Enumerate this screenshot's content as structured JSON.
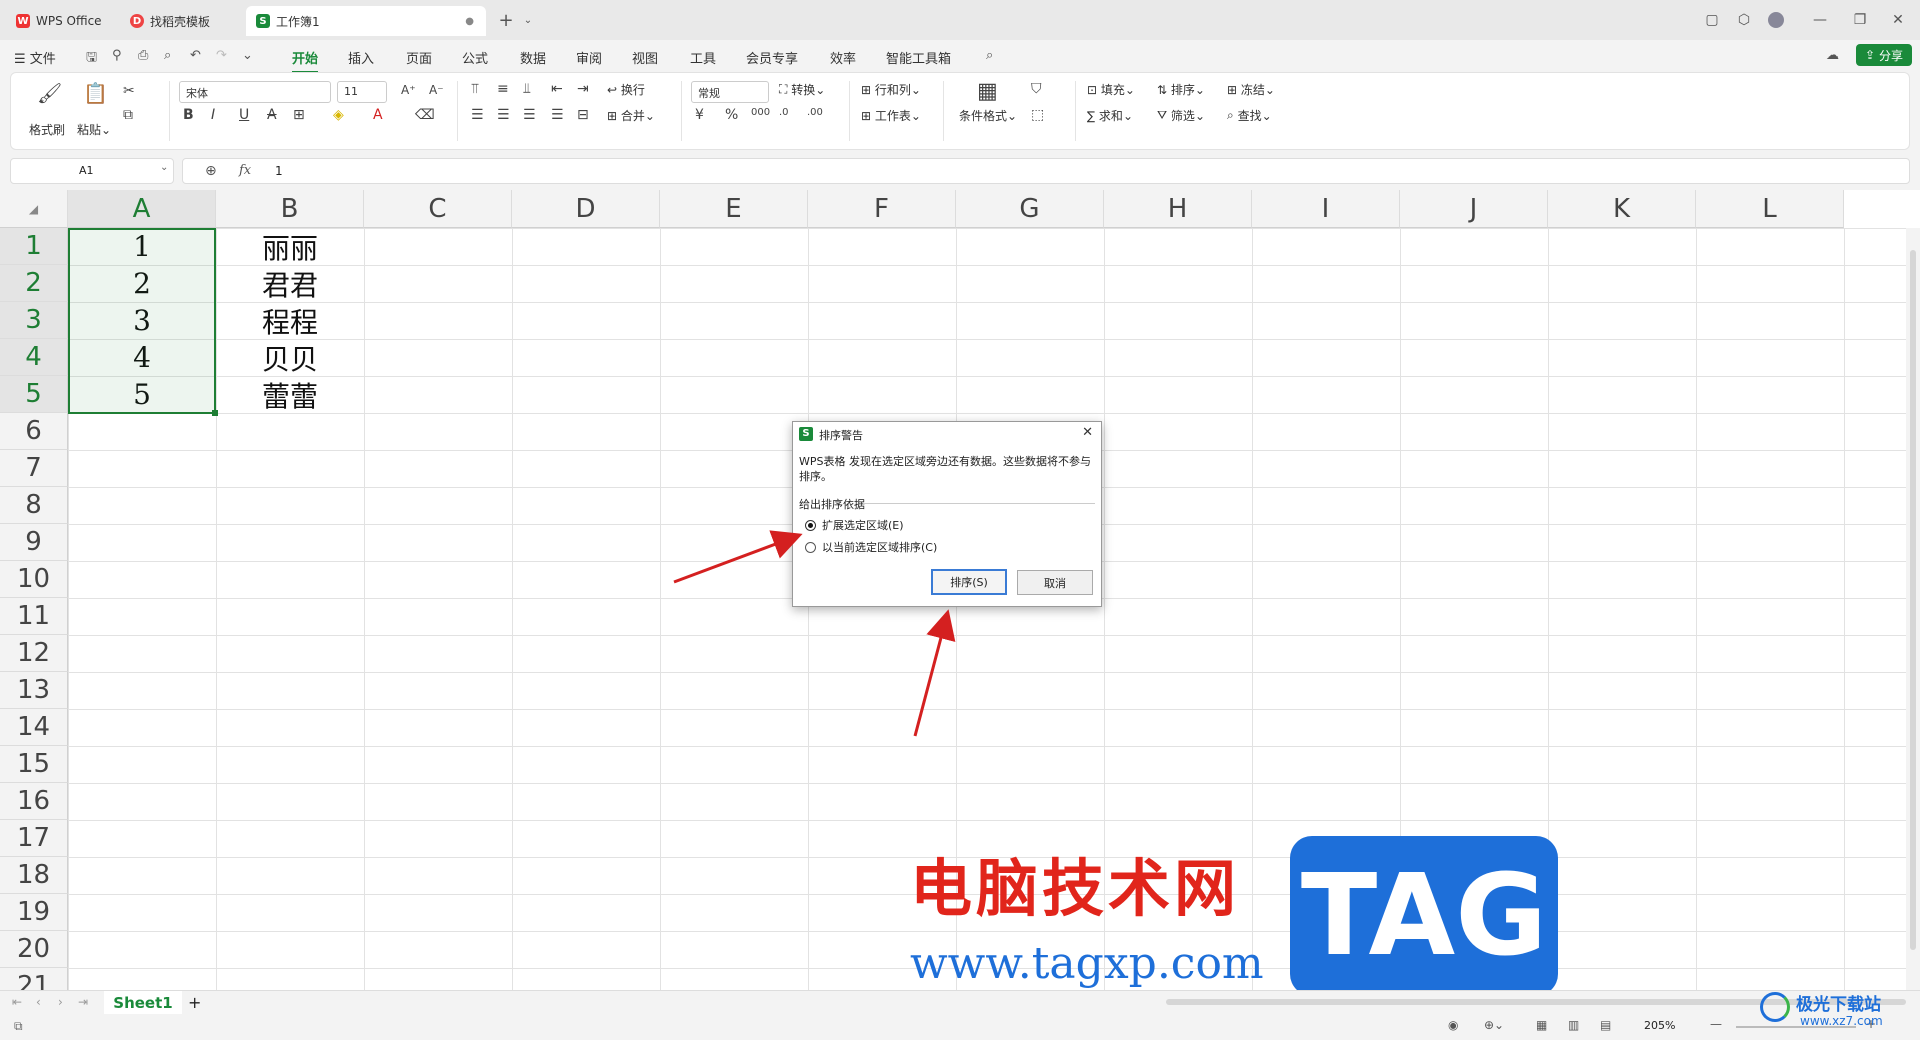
{
  "titlebar": {
    "tabs": [
      {
        "label": "WPS Office",
        "icon": "wps-logo-icon"
      },
      {
        "label": "找稻壳模板",
        "icon": "docer-icon"
      },
      {
        "label": "工作簿1",
        "icon": "sheet-s-icon"
      }
    ]
  },
  "menubar": {
    "file": "文件",
    "items": [
      "开始",
      "插入",
      "页面",
      "公式",
      "数据",
      "审阅",
      "视图",
      "工具",
      "会员专享",
      "效率",
      "智能工具箱"
    ],
    "share": "分享"
  },
  "ribbon": {
    "format_painter": "格式刷",
    "paste": "粘贴",
    "font": "宋体",
    "font_size": "11",
    "wrap": "换行",
    "merge": "合并",
    "number_format": "常规",
    "convert": "转换",
    "row_col": "行和列",
    "worksheet": "工作表",
    "cond_format": "条件格式",
    "fill": "填充",
    "sort": "排序",
    "freeze": "冻结",
    "sum": "求和",
    "filter": "筛选",
    "find": "查找"
  },
  "formula_bar": {
    "cell_ref": "A1",
    "fx": "fx",
    "value": "1"
  },
  "sheet": {
    "columns": [
      "A",
      "B",
      "C",
      "D",
      "E",
      "F",
      "G",
      "H",
      "I",
      "J",
      "K",
      "L"
    ],
    "rows": [
      "1",
      "2",
      "3",
      "4",
      "5",
      "6",
      "7",
      "8",
      "9",
      "10",
      "11",
      "12",
      "13",
      "14",
      "15",
      "16",
      "17",
      "18",
      "19",
      "20",
      "21"
    ],
    "col_a": [
      "1",
      "2",
      "3",
      "4",
      "5"
    ],
    "col_b": [
      "丽丽",
      "君君",
      "程程",
      "贝贝",
      "蕾蕾"
    ]
  },
  "dialog": {
    "title": "排序警告",
    "message": "WPS表格 发现在选定区域旁边还有数据。这些数据将不参与排序。",
    "group": "给出排序依据",
    "option1": "扩展选定区域(E)",
    "option2": "以当前选定区域排序(C)",
    "sort_button": "排序(S)",
    "cancel_button": "取消"
  },
  "sheet_tabs": {
    "active": "Sheet1",
    "add": "+"
  },
  "status": {
    "zoom": "205%"
  },
  "watermark": {
    "title": "电脑技术网",
    "url": "www.tagxp.com",
    "tag": "TAG",
    "corner": "极光下载站",
    "corner_url": "www.xz7.com"
  },
  "colors": {
    "accent": "#1a8a3a",
    "arrow": "#d42020",
    "watermark_red": "#e1251b",
    "watermark_blue": "#1e6fd9"
  }
}
